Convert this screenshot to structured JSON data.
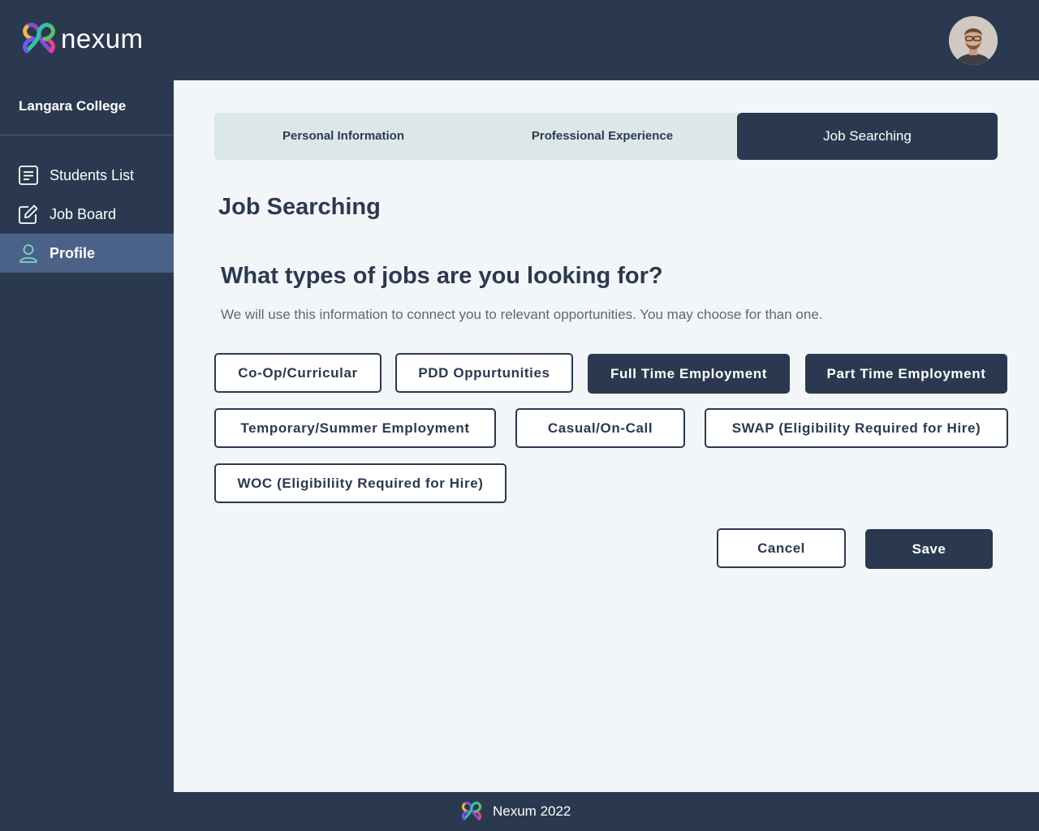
{
  "brand": {
    "name": "nexum"
  },
  "sidebar": {
    "org": "Langara College",
    "items": [
      {
        "label": "Students List",
        "icon": "list-icon"
      },
      {
        "label": "Job Board",
        "icon": "edit-icon"
      },
      {
        "label": "Profile",
        "icon": "user-icon",
        "active": true
      }
    ]
  },
  "tabs": [
    {
      "label": "Personal Information"
    },
    {
      "label": "Professional Experience"
    },
    {
      "label": "Job Searching",
      "active": true
    }
  ],
  "page": {
    "title": "Job Searching",
    "question": "What types of jobs are you looking for?",
    "helper": "We will use this information to connect you to relevant opportunities. You may choose for than one."
  },
  "job_types": [
    {
      "label": "Co-Op/Curricular",
      "selected": false
    },
    {
      "label": "PDD Oppurtunities",
      "selected": false
    },
    {
      "label": "Full Time Employment",
      "selected": true
    },
    {
      "label": "Part Time Employment",
      "selected": true
    },
    {
      "label": "Temporary/Summer Employment",
      "selected": false
    },
    {
      "label": "Casual/On-Call",
      "selected": false
    },
    {
      "label": "SWAP (Eligibility Required for Hire)",
      "selected": false
    },
    {
      "label": "WOC (Eligibiliity Required for Hire)",
      "selected": false
    }
  ],
  "actions": {
    "cancel": "Cancel",
    "save": "Save"
  },
  "footer": {
    "text": "Nexum 2022"
  },
  "colors": {
    "navy": "#2b3950",
    "active_nav": "#4b6288",
    "tab_bg": "#dce8e7",
    "content_bg": "#f3f6f8"
  }
}
